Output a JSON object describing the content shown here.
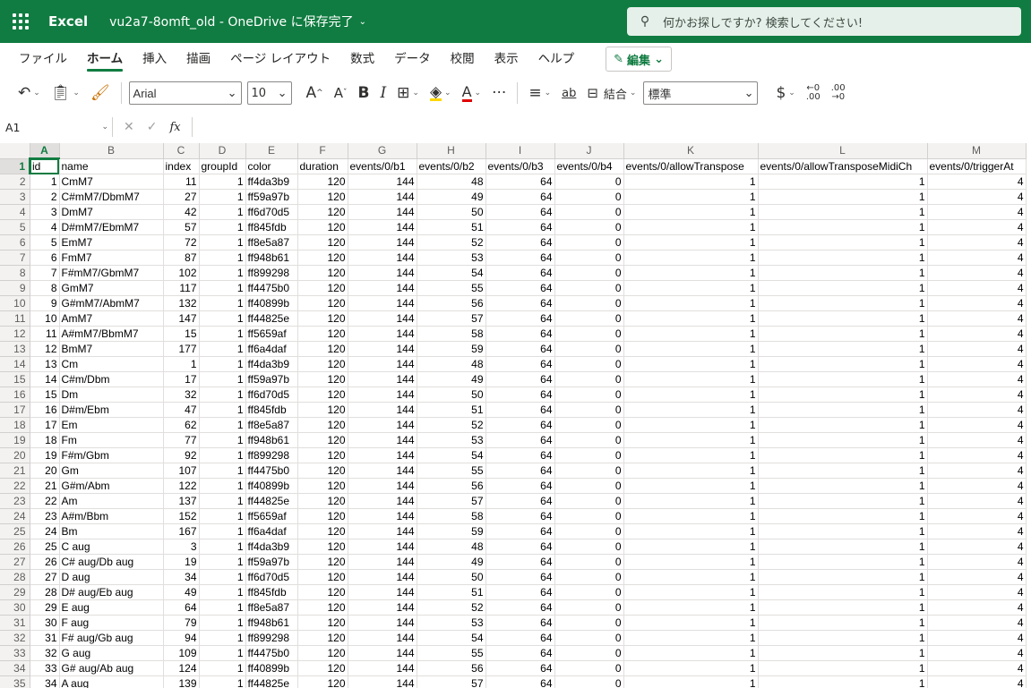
{
  "topbar": {
    "app_name": "Excel",
    "doc_title": "vu2a7-8omft_old - OneDrive に保存完了",
    "search_placeholder": "何かお探しですか? 検索してください!"
  },
  "tabs": [
    "ファイル",
    "ホーム",
    "挿入",
    "描画",
    "ページ レイアウト",
    "数式",
    "データ",
    "校閲",
    "表示",
    "ヘルプ"
  ],
  "active_tab": "ホーム",
  "edit_button": "編集",
  "toolbar": {
    "font_name": "Arial",
    "font_size": "10",
    "grow_font": "A",
    "shrink_font": "A",
    "bold": "B",
    "italic": "I",
    "font_color_label": "A",
    "more": "···",
    "wrap_label": "ab",
    "merge_label": "結合",
    "number_format": "標準",
    "currency": "$",
    "dec_increase_top": "←0",
    "dec_increase_bottom": ".00",
    "dec_decrease_top": ".00",
    "dec_decrease_bottom": "→0"
  },
  "formula_bar": {
    "cell_ref": "A1",
    "fx": "fx",
    "formula": ""
  },
  "grid": {
    "columns": [
      "A",
      "B",
      "C",
      "D",
      "E",
      "F",
      "G",
      "H",
      "I",
      "J",
      "K",
      "L",
      "M"
    ],
    "selected_column": "A",
    "selected_row": 1,
    "header_row": [
      "id",
      "name",
      "index",
      "groupId",
      "color",
      "duration",
      "events/0/b1",
      "events/0/b2",
      "events/0/b3",
      "events/0/b4",
      "events/0/allowTranspose",
      "events/0/allowTransposeMidiCh",
      "events/0/triggerAt"
    ],
    "rows": [
      [
        "1",
        "CmM7",
        "11",
        "1",
        "ff4da3b9",
        "120",
        "144",
        "48",
        "64",
        "0",
        "1",
        "1",
        "4"
      ],
      [
        "2",
        "C#mM7/DbmM7",
        "27",
        "1",
        "ff59a97b",
        "120",
        "144",
        "49",
        "64",
        "0",
        "1",
        "1",
        "4"
      ],
      [
        "3",
        "DmM7",
        "42",
        "1",
        "ff6d70d5",
        "120",
        "144",
        "50",
        "64",
        "0",
        "1",
        "1",
        "4"
      ],
      [
        "4",
        "D#mM7/EbmM7",
        "57",
        "1",
        "ff845fdb",
        "120",
        "144",
        "51",
        "64",
        "0",
        "1",
        "1",
        "4"
      ],
      [
        "5",
        "EmM7",
        "72",
        "1",
        "ff8e5a87",
        "120",
        "144",
        "52",
        "64",
        "0",
        "1",
        "1",
        "4"
      ],
      [
        "6",
        "FmM7",
        "87",
        "1",
        "ff948b61",
        "120",
        "144",
        "53",
        "64",
        "0",
        "1",
        "1",
        "4"
      ],
      [
        "7",
        "F#mM7/GbmM7",
        "102",
        "1",
        "ff899298",
        "120",
        "144",
        "54",
        "64",
        "0",
        "1",
        "1",
        "4"
      ],
      [
        "8",
        "GmM7",
        "117",
        "1",
        "ff4475b0",
        "120",
        "144",
        "55",
        "64",
        "0",
        "1",
        "1",
        "4"
      ],
      [
        "9",
        "G#mM7/AbmM7",
        "132",
        "1",
        "ff40899b",
        "120",
        "144",
        "56",
        "64",
        "0",
        "1",
        "1",
        "4"
      ],
      [
        "10",
        "AmM7",
        "147",
        "1",
        "ff44825e",
        "120",
        "144",
        "57",
        "64",
        "0",
        "1",
        "1",
        "4"
      ],
      [
        "11",
        "A#mM7/BbmM7",
        "15",
        "1",
        "ff5659af",
        "120",
        "144",
        "58",
        "64",
        "0",
        "1",
        "1",
        "4"
      ],
      [
        "12",
        "BmM7",
        "177",
        "1",
        "ff6a4daf",
        "120",
        "144",
        "59",
        "64",
        "0",
        "1",
        "1",
        "4"
      ],
      [
        "13",
        "Cm",
        "1",
        "1",
        "ff4da3b9",
        "120",
        "144",
        "48",
        "64",
        "0",
        "1",
        "1",
        "4"
      ],
      [
        "14",
        "C#m/Dbm",
        "17",
        "1",
        "ff59a97b",
        "120",
        "144",
        "49",
        "64",
        "0",
        "1",
        "1",
        "4"
      ],
      [
        "15",
        "Dm",
        "32",
        "1",
        "ff6d70d5",
        "120",
        "144",
        "50",
        "64",
        "0",
        "1",
        "1",
        "4"
      ],
      [
        "16",
        "D#m/Ebm",
        "47",
        "1",
        "ff845fdb",
        "120",
        "144",
        "51",
        "64",
        "0",
        "1",
        "1",
        "4"
      ],
      [
        "17",
        "Em",
        "62",
        "1",
        "ff8e5a87",
        "120",
        "144",
        "52",
        "64",
        "0",
        "1",
        "1",
        "4"
      ],
      [
        "18",
        "Fm",
        "77",
        "1",
        "ff948b61",
        "120",
        "144",
        "53",
        "64",
        "0",
        "1",
        "1",
        "4"
      ],
      [
        "19",
        "F#m/Gbm",
        "92",
        "1",
        "ff899298",
        "120",
        "144",
        "54",
        "64",
        "0",
        "1",
        "1",
        "4"
      ],
      [
        "20",
        "Gm",
        "107",
        "1",
        "ff4475b0",
        "120",
        "144",
        "55",
        "64",
        "0",
        "1",
        "1",
        "4"
      ],
      [
        "21",
        "G#m/Abm",
        "122",
        "1",
        "ff40899b",
        "120",
        "144",
        "56",
        "64",
        "0",
        "1",
        "1",
        "4"
      ],
      [
        "22",
        "Am",
        "137",
        "1",
        "ff44825e",
        "120",
        "144",
        "57",
        "64",
        "0",
        "1",
        "1",
        "4"
      ],
      [
        "23",
        "A#m/Bbm",
        "152",
        "1",
        "ff5659af",
        "120",
        "144",
        "58",
        "64",
        "0",
        "1",
        "1",
        "4"
      ],
      [
        "24",
        "Bm",
        "167",
        "1",
        "ff6a4daf",
        "120",
        "144",
        "59",
        "64",
        "0",
        "1",
        "1",
        "4"
      ],
      [
        "25",
        "C aug",
        "3",
        "1",
        "ff4da3b9",
        "120",
        "144",
        "48",
        "64",
        "0",
        "1",
        "1",
        "4"
      ],
      [
        "26",
        "C# aug/Db aug",
        "19",
        "1",
        "ff59a97b",
        "120",
        "144",
        "49",
        "64",
        "0",
        "1",
        "1",
        "4"
      ],
      [
        "27",
        "D aug",
        "34",
        "1",
        "ff6d70d5",
        "120",
        "144",
        "50",
        "64",
        "0",
        "1",
        "1",
        "4"
      ],
      [
        "28",
        "D# aug/Eb aug",
        "49",
        "1",
        "ff845fdb",
        "120",
        "144",
        "51",
        "64",
        "0",
        "1",
        "1",
        "4"
      ],
      [
        "29",
        "E aug",
        "64",
        "1",
        "ff8e5a87",
        "120",
        "144",
        "52",
        "64",
        "0",
        "1",
        "1",
        "4"
      ],
      [
        "30",
        "F aug",
        "79",
        "1",
        "ff948b61",
        "120",
        "144",
        "53",
        "64",
        "0",
        "1",
        "1",
        "4"
      ],
      [
        "31",
        "F# aug/Gb aug",
        "94",
        "1",
        "ff899298",
        "120",
        "144",
        "54",
        "64",
        "0",
        "1",
        "1",
        "4"
      ],
      [
        "32",
        "G aug",
        "109",
        "1",
        "ff4475b0",
        "120",
        "144",
        "55",
        "64",
        "0",
        "1",
        "1",
        "4"
      ],
      [
        "33",
        "G# aug/Ab aug",
        "124",
        "1",
        "ff40899b",
        "120",
        "144",
        "56",
        "64",
        "0",
        "1",
        "1",
        "4"
      ],
      [
        "34",
        "A aug",
        "139",
        "1",
        "ff44825e",
        "120",
        "144",
        "57",
        "64",
        "0",
        "1",
        "1",
        "4"
      ]
    ]
  },
  "colors": {
    "brand_green": "#107c41",
    "fill_highlight": "#ffd700",
    "font_color": "#e00000"
  }
}
